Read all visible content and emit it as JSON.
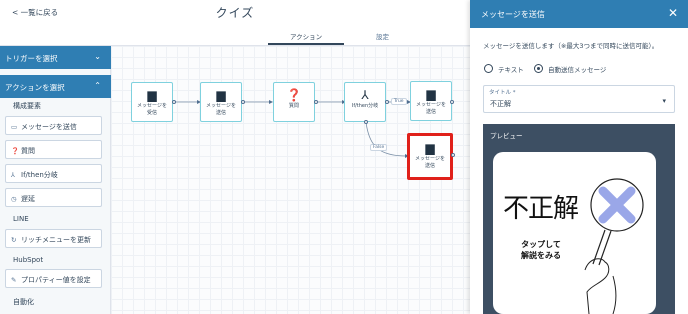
{
  "header": {
    "back_label": "< 一覧に戻る",
    "title": "クイズ",
    "tabs": [
      {
        "label": "アクション",
        "active": true
      },
      {
        "label": "設定",
        "active": false
      }
    ]
  },
  "sidebar": {
    "trigger_header": "トリガーを選択",
    "action_header": "アクションを選択",
    "sections": [
      {
        "label": "構成要素"
      },
      {
        "label": "LINE"
      },
      {
        "label": "HubSpot"
      },
      {
        "label": "自動化"
      }
    ],
    "items": [
      {
        "icon": "message-icon",
        "glyph": "▭",
        "label": "メッセージを送信"
      },
      {
        "icon": "question-icon",
        "glyph": "❓",
        "label": "質問"
      },
      {
        "icon": "branch-icon",
        "glyph": "⅄",
        "label": "If/then分岐"
      },
      {
        "icon": "clock-icon",
        "glyph": "◷",
        "label": "遅延"
      },
      {
        "icon": "refresh-icon",
        "glyph": "↻",
        "label": "リッチメニューを更新"
      },
      {
        "icon": "pencil-icon",
        "glyph": "✎",
        "label": "プロパティー値を設定"
      }
    ]
  },
  "canvas": {
    "nodes": [
      {
        "icon": "message-icon",
        "label": "メッセージを\n受信"
      },
      {
        "icon": "message-icon",
        "label": "メッセージを\n送信"
      },
      {
        "icon": "question-icon",
        "label": "質問"
      },
      {
        "icon": "branch-icon",
        "label": "If/then分岐"
      },
      {
        "icon": "message-icon",
        "label": "メッセージを\n送信"
      },
      {
        "icon": "message-icon",
        "label": "メッセージを\n送信"
      }
    ],
    "edge_labels": {
      "true_label": "True",
      "false_label": "False"
    },
    "accent_color": "#7fd1de",
    "selected_color": "#e0201a"
  },
  "right_panel": {
    "title": "メッセージを送信",
    "description": "メッセージを送信します（※最大3つまで同時に送信可能）。",
    "radio_text": "テキスト",
    "radio_auto": "自動送信メッセージ",
    "selected_radio": "自動送信メッセージ",
    "select_label": "タイトル *",
    "select_value": "不正解",
    "preview_label": "プレビュー",
    "preview_image": {
      "big_text": "不正解",
      "line1": "タップして",
      "line2": "解説をみる"
    },
    "header_color": "#2f7eb3"
  }
}
